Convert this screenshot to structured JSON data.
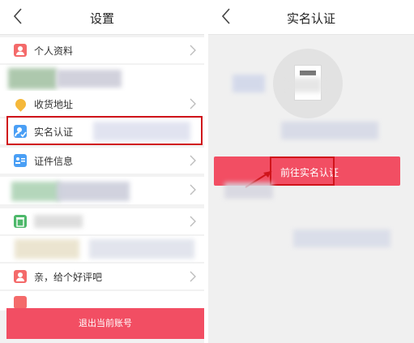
{
  "left": {
    "title": "设置",
    "items": [
      {
        "label": "个人资料",
        "icon": "person-icon",
        "color": "#f46a6a"
      },
      {
        "label": "收货地址",
        "icon": "location-pin-icon",
        "color": "#f5b83a"
      },
      {
        "label": "实名认证",
        "icon": "verified-user-icon",
        "color": "#4a9ff5"
      },
      {
        "label": "证件信息",
        "icon": "id-card-icon",
        "color": "#4a9ff5"
      },
      {
        "label": "",
        "icon": "trash-icon",
        "color": "#4db86a"
      },
      {
        "label": "亲，给个好评吧",
        "icon": "person-icon",
        "color": "#f46a6a"
      }
    ],
    "logout_label": "退出当前账号"
  },
  "right": {
    "title": "实名认证",
    "button_label": "前往实名认证"
  },
  "colors": {
    "accent": "#f24e63",
    "highlight": "#d0141b"
  }
}
